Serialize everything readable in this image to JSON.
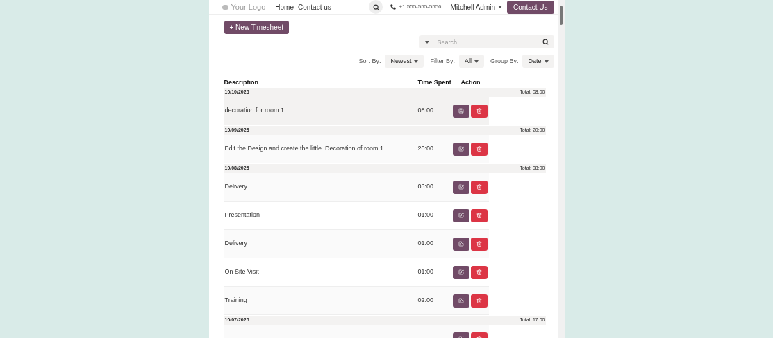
{
  "header": {
    "logo": "Your Logo",
    "nav": [
      "Home",
      "Contact us"
    ],
    "phone": "+1 555-555-5556",
    "user": "Mitchell Admin",
    "cta": "Contact Us"
  },
  "new_button": "+ New Timesheet",
  "search": {
    "placeholder": "Search"
  },
  "controls": [
    {
      "label": "Sort By:",
      "value": "Newest"
    },
    {
      "label": "Filter By:",
      "value": "All"
    },
    {
      "label": "Group By:",
      "value": "Date"
    }
  ],
  "table": {
    "columns": [
      "Description",
      "Time Spent",
      "Action"
    ],
    "groups": [
      {
        "date": "10/10/2025",
        "total": "Total: 08:00",
        "rows": [
          {
            "description": "decoration for room 1",
            "time": "08:00",
            "editing": true
          }
        ]
      },
      {
        "date": "10/09/2025",
        "total": "Total: 20:00",
        "rows": [
          {
            "description": "Edit the Design and create the little. Decoration of room 1.",
            "time": "20:00",
            "editing": false
          }
        ]
      },
      {
        "date": "10/08/2025",
        "total": "Total: 08:00",
        "rows": [
          {
            "description": "Delivery",
            "time": "03:00",
            "editing": false
          },
          {
            "description": "Presentation",
            "time": "01:00",
            "editing": false
          },
          {
            "description": "Delivery",
            "time": "01:00",
            "editing": false
          },
          {
            "description": "On Site Visit",
            "time": "01:00",
            "editing": false
          },
          {
            "description": "Training",
            "time": "02:00",
            "editing": false
          }
        ]
      },
      {
        "date": "10/07/2025",
        "total": "Total: 17:00",
        "rows": [
          {
            "editing": false
          }
        ]
      }
    ]
  }
}
